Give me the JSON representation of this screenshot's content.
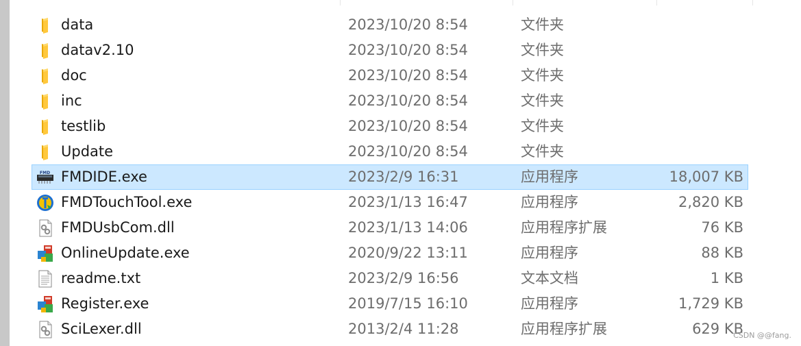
{
  "files": [
    {
      "name": "data",
      "date": "2023/10/20 8:54",
      "type": "文件夹",
      "size": "",
      "icon": "folder-icon"
    },
    {
      "name": "datav2.10",
      "date": "2023/10/20 8:54",
      "type": "文件夹",
      "size": "",
      "icon": "folder-icon"
    },
    {
      "name": "doc",
      "date": "2023/10/20 8:54",
      "type": "文件夹",
      "size": "",
      "icon": "folder-icon"
    },
    {
      "name": "inc",
      "date": "2023/10/20 8:54",
      "type": "文件夹",
      "size": "",
      "icon": "folder-icon"
    },
    {
      "name": "testlib",
      "date": "2023/10/20 8:54",
      "type": "文件夹",
      "size": "",
      "icon": "folder-icon"
    },
    {
      "name": "Update",
      "date": "2023/10/20 8:54",
      "type": "文件夹",
      "size": "",
      "icon": "folder-icon"
    },
    {
      "name": "FMDIDE.exe",
      "date": "2023/2/9 16:31",
      "type": "应用程序",
      "size": "18,007 KB",
      "icon": "fmd-chip-icon",
      "selected": true
    },
    {
      "name": "FMDTouchTool.exe",
      "date": "2023/1/13 16:47",
      "type": "应用程序",
      "size": "2,820 KB",
      "icon": "touch-tool-icon"
    },
    {
      "name": "FMDUsbCom.dll",
      "date": "2023/1/13 14:06",
      "type": "应用程序扩展",
      "size": "76 KB",
      "icon": "dll-gear-icon"
    },
    {
      "name": "OnlineUpdate.exe",
      "date": "2020/9/22 13:11",
      "type": "应用程序",
      "size": "88 KB",
      "icon": "installer-icon"
    },
    {
      "name": "readme.txt",
      "date": "2023/2/9 16:56",
      "type": "文本文档",
      "size": "1 KB",
      "icon": "text-file-icon"
    },
    {
      "name": "Register.exe",
      "date": "2019/7/15 16:10",
      "type": "应用程序",
      "size": "1,729 KB",
      "icon": "installer-icon"
    },
    {
      "name": "SciLexer.dll",
      "date": "2013/2/4 11:28",
      "type": "应用程序扩展",
      "size": "629 KB",
      "icon": "dll-gear-icon"
    }
  ],
  "watermark": "CSDN @@fang.",
  "colors": {
    "selection_bg": "#cce8ff",
    "selection_border": "#99d1ff",
    "folder": "#ffc83d",
    "name_text": "#1a1a1a",
    "meta_text": "#6d6d6d"
  }
}
